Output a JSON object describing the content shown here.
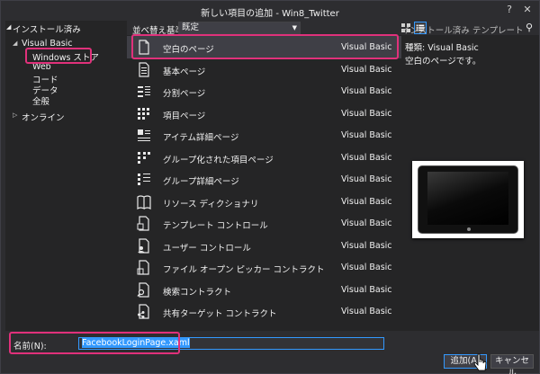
{
  "window": {
    "title": "新しい項目の追加 - Win8_Twitter",
    "help": "?",
    "close": "✕"
  },
  "left": {
    "header": "インストール済み",
    "tree": [
      {
        "label": "Visual Basic",
        "expanded": true
      },
      {
        "label": "Windows ストア"
      },
      {
        "label": "Web"
      },
      {
        "label": "コード"
      },
      {
        "label": "データ"
      },
      {
        "label": "全般"
      },
      {
        "label": "オンライン",
        "expanded": false
      }
    ]
  },
  "toolbar": {
    "sort_label": "並べ替え基準:",
    "sort_value": "既定",
    "search_placeholder": "インストール済み テンプレート の検索 (Ctrl"
  },
  "items": [
    {
      "name": "空白のページ",
      "lang": "Visual Basic",
      "icon": "blank-page-icon",
      "selected": true
    },
    {
      "name": "基本ページ",
      "lang": "Visual Basic",
      "icon": "basic-page-icon"
    },
    {
      "name": "分割ページ",
      "lang": "Visual Basic",
      "icon": "split-page-icon"
    },
    {
      "name": "項目ページ",
      "lang": "Visual Basic",
      "icon": "items-page-icon"
    },
    {
      "name": "アイテム詳細ページ",
      "lang": "Visual Basic",
      "icon": "item-detail-page-icon"
    },
    {
      "name": "グループ化された項目ページ",
      "lang": "Visual Basic",
      "icon": "grouped-items-page-icon"
    },
    {
      "name": "グループ詳細ページ",
      "lang": "Visual Basic",
      "icon": "group-detail-page-icon"
    },
    {
      "name": "リソース ディクショナリ",
      "lang": "Visual Basic",
      "icon": "resource-dictionary-icon"
    },
    {
      "name": "テンプレート コントロール",
      "lang": "Visual Basic",
      "icon": "templated-control-icon"
    },
    {
      "name": "ユーザー コントロール",
      "lang": "Visual Basic",
      "icon": "user-control-icon"
    },
    {
      "name": "ファイル オープン ピッカー コントラクト",
      "lang": "Visual Basic",
      "icon": "file-open-picker-icon"
    },
    {
      "name": "検索コントラクト",
      "lang": "Visual Basic",
      "icon": "search-contract-icon"
    },
    {
      "name": "共有ターゲット コントラクト",
      "lang": "Visual Basic",
      "icon": "share-target-icon"
    }
  ],
  "details": {
    "type_label": "種類: Visual Basic",
    "description": "空白のページです。"
  },
  "bottom": {
    "name_label": "名前(N):",
    "name_value": "FacebookLoginPage.xaml",
    "add_label": "追加(A)",
    "cancel_label": "キャンセル"
  },
  "colors": {
    "accent": "#3399ff",
    "highlight": "#e0317b",
    "background": "#2d2d30",
    "panel": "#252526"
  }
}
